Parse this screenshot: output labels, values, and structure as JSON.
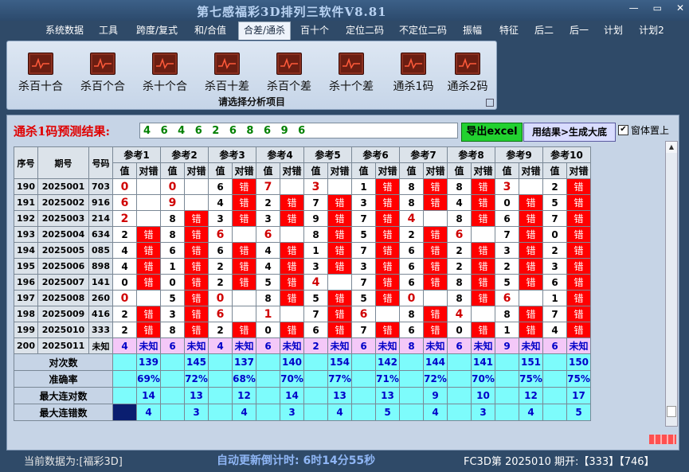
{
  "app": {
    "title": "第七感福彩3D排列三软件V8.81"
  },
  "window_buttons": [
    "—",
    "▭",
    "✕"
  ],
  "menu": [
    "系统数据",
    "工具",
    "跨度/复式",
    "和/合值",
    "合差/通杀",
    "百十个",
    "定位二码",
    "不定位二码",
    "振幅",
    "特征",
    "后二",
    "后一",
    "计划",
    "计划2"
  ],
  "menu_active": 4,
  "ribbon": {
    "buttons": [
      "杀百十合",
      "杀百个合",
      "杀十个合",
      "杀百十差",
      "杀百个差",
      "杀十个差",
      "通杀1码",
      "通杀2码"
    ],
    "caption": "请选择分析项目"
  },
  "prediction": {
    "label": "通杀1码预测结果:",
    "value": "4 6 4 6 2 6 8 6 9 6"
  },
  "buttons": {
    "excel": "导出excel",
    "generate": "用结果>生成大底"
  },
  "checkbox": {
    "label": "窗体置上",
    "checked": true
  },
  "table": {
    "headers": {
      "seq": "序号",
      "issue": "期号",
      "number": "号码",
      "value": "值",
      "judge": "对错"
    },
    "refs": [
      "参考1",
      "参考2",
      "参考3",
      "参考4",
      "参考5",
      "参考6",
      "参考7",
      "参考8",
      "参考9",
      "参考10"
    ],
    "rows": [
      {
        "seq": "190",
        "issue": "2025001",
        "num": "703",
        "cells": [
          [
            "0",
            0
          ],
          [
            "0",
            0
          ],
          [
            "6",
            1
          ],
          [
            "7",
            0
          ],
          [
            "3",
            0
          ],
          [
            "1",
            1
          ],
          [
            "8",
            1
          ],
          [
            "8",
            1
          ],
          [
            "3",
            0
          ],
          [
            "2",
            1
          ]
        ]
      },
      {
        "seq": "191",
        "issue": "2025002",
        "num": "916",
        "cells": [
          [
            "6",
            0
          ],
          [
            "9",
            0
          ],
          [
            "4",
            1
          ],
          [
            "2",
            1
          ],
          [
            "7",
            1
          ],
          [
            "3",
            1
          ],
          [
            "8",
            1
          ],
          [
            "4",
            1
          ],
          [
            "0",
            1
          ],
          [
            "5",
            1
          ]
        ]
      },
      {
        "seq": "192",
        "issue": "2025003",
        "num": "214",
        "cells": [
          [
            "2",
            0
          ],
          [
            "8",
            1
          ],
          [
            "3",
            1
          ],
          [
            "3",
            1
          ],
          [
            "9",
            1
          ],
          [
            "7",
            1
          ],
          [
            "4",
            0
          ],
          [
            "8",
            1
          ],
          [
            "6",
            1
          ],
          [
            "7",
            1
          ]
        ]
      },
      {
        "seq": "193",
        "issue": "2025004",
        "num": "634",
        "cells": [
          [
            "2",
            1
          ],
          [
            "8",
            1
          ],
          [
            "6",
            0
          ],
          [
            "6",
            0
          ],
          [
            "8",
            1
          ],
          [
            "5",
            1
          ],
          [
            "2",
            1
          ],
          [
            "6",
            0
          ],
          [
            "7",
            1
          ],
          [
            "0",
            1
          ]
        ]
      },
      {
        "seq": "194",
        "issue": "2025005",
        "num": "085",
        "cells": [
          [
            "4",
            1
          ],
          [
            "6",
            1
          ],
          [
            "6",
            1
          ],
          [
            "4",
            1
          ],
          [
            "1",
            1
          ],
          [
            "7",
            1
          ],
          [
            "6",
            1
          ],
          [
            "2",
            1
          ],
          [
            "3",
            1
          ],
          [
            "2",
            1
          ]
        ]
      },
      {
        "seq": "195",
        "issue": "2025006",
        "num": "898",
        "cells": [
          [
            "4",
            1
          ],
          [
            "1",
            1
          ],
          [
            "2",
            1
          ],
          [
            "4",
            1
          ],
          [
            "3",
            1
          ],
          [
            "3",
            1
          ],
          [
            "6",
            1
          ],
          [
            "2",
            1
          ],
          [
            "2",
            1
          ],
          [
            "3",
            1
          ]
        ]
      },
      {
        "seq": "196",
        "issue": "2025007",
        "num": "141",
        "cells": [
          [
            "0",
            1
          ],
          [
            "0",
            1
          ],
          [
            "2",
            1
          ],
          [
            "5",
            1
          ],
          [
            "4",
            0
          ],
          [
            "7",
            1
          ],
          [
            "6",
            1
          ],
          [
            "8",
            1
          ],
          [
            "5",
            1
          ],
          [
            "6",
            1
          ]
        ]
      },
      {
        "seq": "197",
        "issue": "2025008",
        "num": "260",
        "cells": [
          [
            "0",
            0
          ],
          [
            "5",
            1
          ],
          [
            "0",
            0
          ],
          [
            "8",
            1
          ],
          [
            "5",
            1
          ],
          [
            "5",
            1
          ],
          [
            "0",
            0
          ],
          [
            "8",
            1
          ],
          [
            "6",
            0
          ],
          [
            "1",
            1
          ]
        ]
      },
      {
        "seq": "198",
        "issue": "2025009",
        "num": "416",
        "cells": [
          [
            "2",
            1
          ],
          [
            "3",
            1
          ],
          [
            "6",
            0
          ],
          [
            "1",
            0
          ],
          [
            "7",
            1
          ],
          [
            "6",
            0
          ],
          [
            "8",
            1
          ],
          [
            "4",
            0
          ],
          [
            "8",
            1
          ],
          [
            "7",
            1
          ]
        ]
      },
      {
        "seq": "199",
        "issue": "2025010",
        "num": "333",
        "cells": [
          [
            "2",
            1
          ],
          [
            "8",
            1
          ],
          [
            "2",
            1
          ],
          [
            "0",
            1
          ],
          [
            "6",
            1
          ],
          [
            "7",
            1
          ],
          [
            "6",
            1
          ],
          [
            "0",
            1
          ],
          [
            "1",
            1
          ],
          [
            "4",
            1
          ]
        ]
      }
    ],
    "unknown_row": {
      "seq": "200",
      "issue": "2025011",
      "num": "未知",
      "values": [
        "4",
        "6",
        "4",
        "6",
        "2",
        "6",
        "8",
        "6",
        "9",
        "6"
      ],
      "judge": "未知"
    },
    "stats": [
      {
        "label": "对次数",
        "values": [
          "139",
          "145",
          "137",
          "140",
          "154",
          "142",
          "144",
          "141",
          "151",
          "150"
        ]
      },
      {
        "label": "准确率",
        "values": [
          "69%",
          "72%",
          "68%",
          "70%",
          "77%",
          "71%",
          "72%",
          "70%",
          "75%",
          "75%"
        ]
      },
      {
        "label": "最大连对数",
        "values": [
          "14",
          "13",
          "12",
          "14",
          "13",
          "13",
          "9",
          "10",
          "12",
          "17"
        ]
      },
      {
        "label": "最大连错数",
        "values": [
          "4",
          "3",
          "4",
          "3",
          "4",
          "5",
          "4",
          "3",
          "4",
          "5"
        ]
      }
    ]
  },
  "statusbar": {
    "current": "当前数据为:[福彩3D]",
    "countdown": "自动更新倒计时: 6时14分55秒",
    "draw": "FC3D第 2025010 期开:【333】【746】"
  }
}
